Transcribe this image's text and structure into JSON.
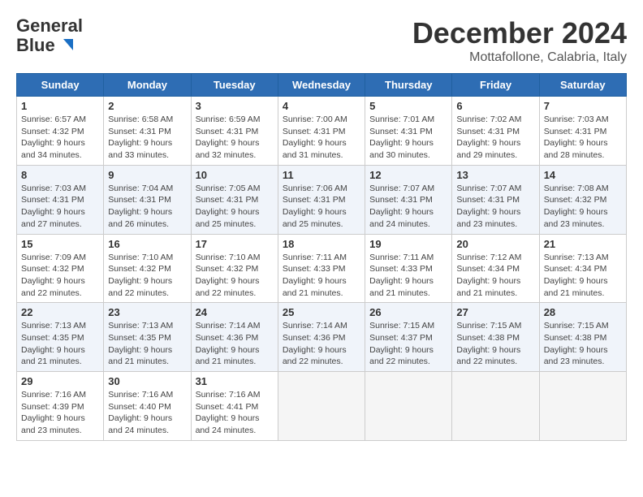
{
  "logo": {
    "general": "General",
    "blue": "Blue"
  },
  "title": "December 2024",
  "subtitle": "Mottafollone, Calabria, Italy",
  "days_of_week": [
    "Sunday",
    "Monday",
    "Tuesday",
    "Wednesday",
    "Thursday",
    "Friday",
    "Saturday"
  ],
  "weeks": [
    [
      {
        "day": "1",
        "info": "Sunrise: 6:57 AM\nSunset: 4:32 PM\nDaylight: 9 hours\nand 34 minutes."
      },
      {
        "day": "2",
        "info": "Sunrise: 6:58 AM\nSunset: 4:31 PM\nDaylight: 9 hours\nand 33 minutes."
      },
      {
        "day": "3",
        "info": "Sunrise: 6:59 AM\nSunset: 4:31 PM\nDaylight: 9 hours\nand 32 minutes."
      },
      {
        "day": "4",
        "info": "Sunrise: 7:00 AM\nSunset: 4:31 PM\nDaylight: 9 hours\nand 31 minutes."
      },
      {
        "day": "5",
        "info": "Sunrise: 7:01 AM\nSunset: 4:31 PM\nDaylight: 9 hours\nand 30 minutes."
      },
      {
        "day": "6",
        "info": "Sunrise: 7:02 AM\nSunset: 4:31 PM\nDaylight: 9 hours\nand 29 minutes."
      },
      {
        "day": "7",
        "info": "Sunrise: 7:03 AM\nSunset: 4:31 PM\nDaylight: 9 hours\nand 28 minutes."
      }
    ],
    [
      {
        "day": "8",
        "info": "Sunrise: 7:03 AM\nSunset: 4:31 PM\nDaylight: 9 hours\nand 27 minutes."
      },
      {
        "day": "9",
        "info": "Sunrise: 7:04 AM\nSunset: 4:31 PM\nDaylight: 9 hours\nand 26 minutes."
      },
      {
        "day": "10",
        "info": "Sunrise: 7:05 AM\nSunset: 4:31 PM\nDaylight: 9 hours\nand 25 minutes."
      },
      {
        "day": "11",
        "info": "Sunrise: 7:06 AM\nSunset: 4:31 PM\nDaylight: 9 hours\nand 25 minutes."
      },
      {
        "day": "12",
        "info": "Sunrise: 7:07 AM\nSunset: 4:31 PM\nDaylight: 9 hours\nand 24 minutes."
      },
      {
        "day": "13",
        "info": "Sunrise: 7:07 AM\nSunset: 4:31 PM\nDaylight: 9 hours\nand 23 minutes."
      },
      {
        "day": "14",
        "info": "Sunrise: 7:08 AM\nSunset: 4:32 PM\nDaylight: 9 hours\nand 23 minutes."
      }
    ],
    [
      {
        "day": "15",
        "info": "Sunrise: 7:09 AM\nSunset: 4:32 PM\nDaylight: 9 hours\nand 22 minutes."
      },
      {
        "day": "16",
        "info": "Sunrise: 7:10 AM\nSunset: 4:32 PM\nDaylight: 9 hours\nand 22 minutes."
      },
      {
        "day": "17",
        "info": "Sunrise: 7:10 AM\nSunset: 4:32 PM\nDaylight: 9 hours\nand 22 minutes."
      },
      {
        "day": "18",
        "info": "Sunrise: 7:11 AM\nSunset: 4:33 PM\nDaylight: 9 hours\nand 21 minutes."
      },
      {
        "day": "19",
        "info": "Sunrise: 7:11 AM\nSunset: 4:33 PM\nDaylight: 9 hours\nand 21 minutes."
      },
      {
        "day": "20",
        "info": "Sunrise: 7:12 AM\nSunset: 4:34 PM\nDaylight: 9 hours\nand 21 minutes."
      },
      {
        "day": "21",
        "info": "Sunrise: 7:13 AM\nSunset: 4:34 PM\nDaylight: 9 hours\nand 21 minutes."
      }
    ],
    [
      {
        "day": "22",
        "info": "Sunrise: 7:13 AM\nSunset: 4:35 PM\nDaylight: 9 hours\nand 21 minutes."
      },
      {
        "day": "23",
        "info": "Sunrise: 7:13 AM\nSunset: 4:35 PM\nDaylight: 9 hours\nand 21 minutes."
      },
      {
        "day": "24",
        "info": "Sunrise: 7:14 AM\nSunset: 4:36 PM\nDaylight: 9 hours\nand 21 minutes."
      },
      {
        "day": "25",
        "info": "Sunrise: 7:14 AM\nSunset: 4:36 PM\nDaylight: 9 hours\nand 22 minutes."
      },
      {
        "day": "26",
        "info": "Sunrise: 7:15 AM\nSunset: 4:37 PM\nDaylight: 9 hours\nand 22 minutes."
      },
      {
        "day": "27",
        "info": "Sunrise: 7:15 AM\nSunset: 4:38 PM\nDaylight: 9 hours\nand 22 minutes."
      },
      {
        "day": "28",
        "info": "Sunrise: 7:15 AM\nSunset: 4:38 PM\nDaylight: 9 hours\nand 23 minutes."
      }
    ],
    [
      {
        "day": "29",
        "info": "Sunrise: 7:16 AM\nSunset: 4:39 PM\nDaylight: 9 hours\nand 23 minutes."
      },
      {
        "day": "30",
        "info": "Sunrise: 7:16 AM\nSunset: 4:40 PM\nDaylight: 9 hours\nand 24 minutes."
      },
      {
        "day": "31",
        "info": "Sunrise: 7:16 AM\nSunset: 4:41 PM\nDaylight: 9 hours\nand 24 minutes."
      },
      null,
      null,
      null,
      null
    ]
  ]
}
